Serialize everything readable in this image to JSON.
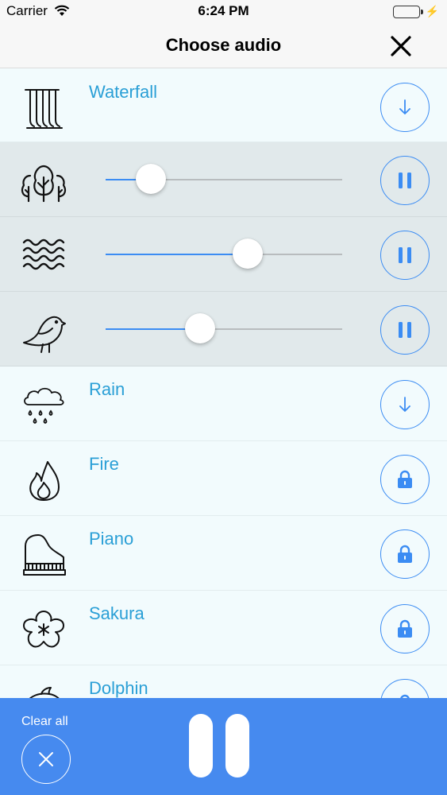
{
  "status_bar": {
    "carrier": "Carrier",
    "time": "6:24 PM"
  },
  "nav": {
    "title": "Choose audio",
    "close_icon": "close-icon"
  },
  "sounds": [
    {
      "name": "Waterfall",
      "icon": "waterfall-icon",
      "state": "download"
    },
    {
      "name": "",
      "icon": "forest-icon",
      "state": "playing",
      "volume": 0.19
    },
    {
      "name": "",
      "icon": "waves-icon",
      "state": "playing",
      "volume": 0.6
    },
    {
      "name": "",
      "icon": "bird-icon",
      "state": "playing",
      "volume": 0.4
    },
    {
      "name": "Rain",
      "icon": "rain-icon",
      "state": "download"
    },
    {
      "name": "Fire",
      "icon": "fire-icon",
      "state": "locked"
    },
    {
      "name": "Piano",
      "icon": "piano-icon",
      "state": "locked"
    },
    {
      "name": "Sakura",
      "icon": "sakura-icon",
      "state": "locked"
    },
    {
      "name": "Dolphin",
      "icon": "dolphin-icon",
      "state": "locked"
    }
  ],
  "bottom_bar": {
    "clear_label": "Clear all"
  },
  "colors": {
    "accent": "#3b8cf3",
    "label": "#2a9fd6",
    "bottom_bar": "#468aef",
    "active_row": "#e1e9eb"
  }
}
